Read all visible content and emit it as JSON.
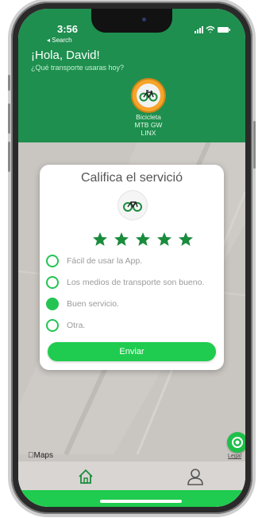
{
  "status_bar": {
    "time": "3:56",
    "back_label": "◂ Search"
  },
  "header": {
    "greeting": "¡Hola, David!",
    "subtitle": "¿Qué transporte usaras hoy?",
    "vehicle_name_lines": [
      "Bicicleta",
      "MTB GW",
      "LINX"
    ]
  },
  "rating_modal": {
    "title": "Califica el servició",
    "stars": 5,
    "options": [
      {
        "label": "Fácil de usar la App.",
        "checked": false
      },
      {
        "label": "Los medios de transporte son bueno.",
        "checked": false
      },
      {
        "label": "Buen servicio.",
        "checked": true
      },
      {
        "label": "Otra.",
        "checked": false
      }
    ],
    "submit_label": "Enviar"
  },
  "map": {
    "attribution": "Maps",
    "legal_label": "Legal"
  },
  "tabbar": {
    "tabs": [
      {
        "icon": "home-icon"
      },
      {
        "icon": "user-icon"
      }
    ]
  },
  "colors": {
    "header_green": "#1e8f4e",
    "accent_green": "#1fcc4f",
    "star_green": "#1a8c3d"
  }
}
